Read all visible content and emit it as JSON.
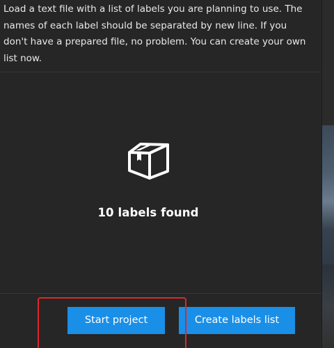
{
  "modal": {
    "description": "Load a text file with a list of labels you are planning to use. The names of each label should be separated by new line. If you don't have a prepared file, no problem. You can create your own list now.",
    "status_text": "10 labels found",
    "status_icon": "box-icon"
  },
  "footer": {
    "start_label": "Start project",
    "create_label": "Create labels list"
  },
  "colors": {
    "accent": "#1a8fe8",
    "highlight": "#e0262a",
    "background": "#262626"
  }
}
